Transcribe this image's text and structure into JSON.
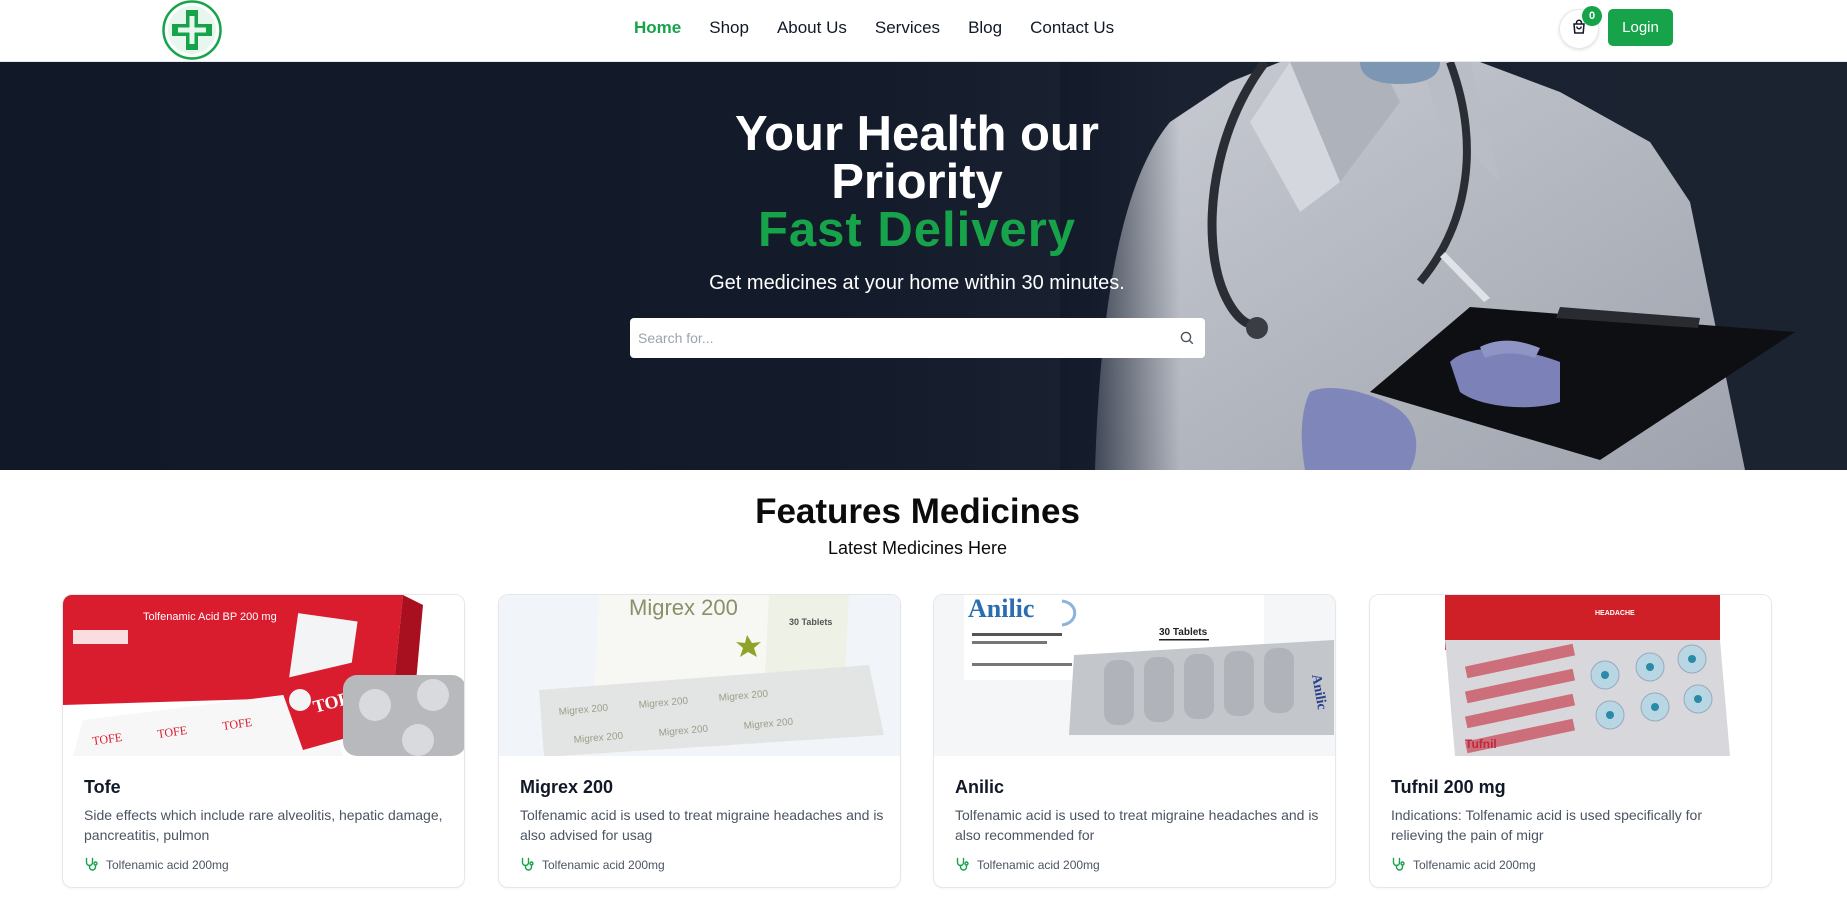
{
  "header": {
    "nav": [
      "Home",
      "Shop",
      "About Us",
      "Services",
      "Blog",
      "Contact Us"
    ],
    "active_nav": "Home",
    "cart_count": "0",
    "login_label": "Login"
  },
  "hero": {
    "title_line1": "Your Health our",
    "title_line2": "Priority",
    "title_highlight": "Fast Delivery",
    "subtitle": "Get medicines at your home within 30 minutes.",
    "search_placeholder": "Search for..."
  },
  "features": {
    "title": "Features Medicines",
    "subtitle": "Latest Medicines Here",
    "products": [
      {
        "name": "Tofe",
        "description": "Side effects which include rare alveolitis, hepatic damage, pancreatitis, pulmon",
        "generic": "Tolfenamic acid 200mg",
        "pack_text": "Tolfenamic Acid BP 200 mg",
        "brand_mark": "TOFE"
      },
      {
        "name": "Migrex 200",
        "description": "Tolfenamic acid is used to treat migraine headaches and is also advised for usag",
        "generic": "Tolfenamic acid 200mg",
        "pack_text": "Migrex 200",
        "brand_mark": "30 Tablets"
      },
      {
        "name": "Anilic",
        "description": "Tolfenamic acid is used to treat migraine headaches and is also recommended for",
        "generic": "Tolfenamic acid 200mg",
        "pack_text": "Anilic",
        "brand_mark": "30 Tablets"
      },
      {
        "name": "Tufnil 200 mg",
        "description": "Indications: Tolfenamic acid is used specifically for relieving the pain of migr",
        "generic": "Tolfenamic acid 200mg",
        "pack_text": "HEADACHE",
        "brand_mark": "Tufnil"
      }
    ]
  },
  "colors": {
    "accent": "#16a34a",
    "hero_bg": "#111827",
    "text": "#111827",
    "muted": "#4b5563"
  },
  "icons": {
    "logo": "medical-cross-icon",
    "cart": "shopping-bag-icon",
    "search": "search-icon",
    "meta": "stethoscope-icon"
  }
}
